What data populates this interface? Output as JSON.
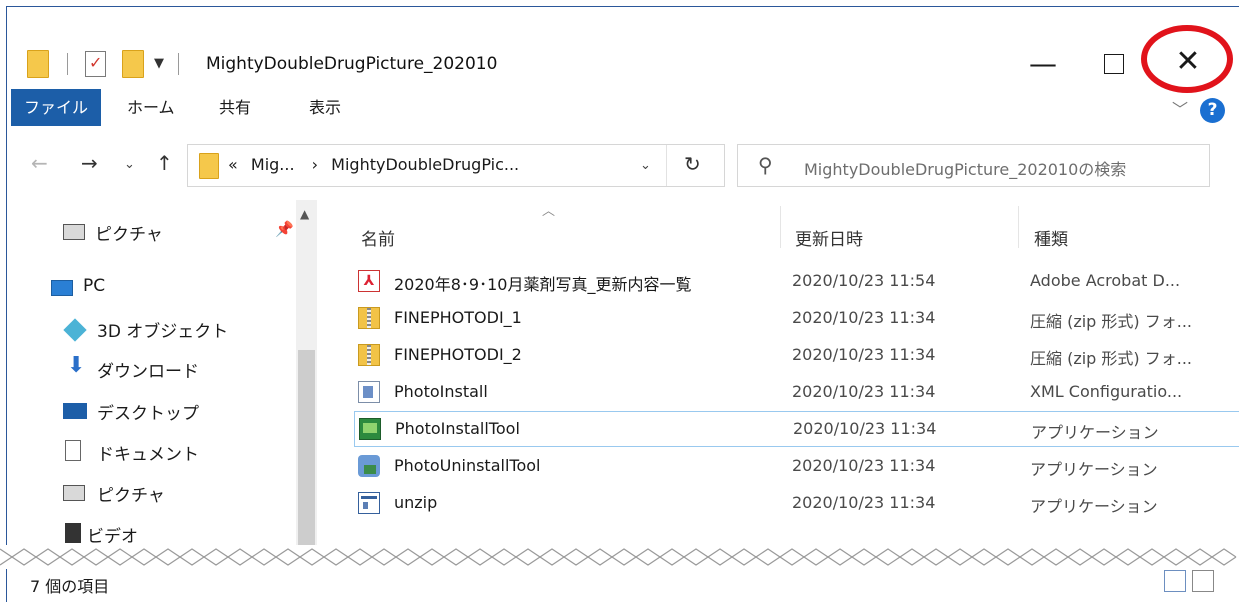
{
  "window": {
    "title": "MightyDoubleDrugPicture_202010",
    "minimize_glyph": "—",
    "close_glyph": "✕"
  },
  "ribbon": {
    "tabs": [
      "ファイル",
      "ホーム",
      "共有",
      "表示"
    ],
    "help_glyph": "?",
    "collapse_glyph": "﹀"
  },
  "address": {
    "overflow": "«",
    "crumb1": "Mig...",
    "sep": "›",
    "crumb2": "MightyDoubleDrugPic...",
    "dropdown_glyph": "⌄",
    "refresh_glyph": "↻"
  },
  "search": {
    "placeholder": "MightyDoubleDrugPicture_202010の検索"
  },
  "nav": {
    "back": "←",
    "forward": "→",
    "recent": "⌄",
    "up": "↑",
    "items": [
      {
        "label": "ピクチャ",
        "icon": "pictures-icon"
      },
      {
        "label": "PC",
        "icon": "pc-icon"
      },
      {
        "label": "3D オブジェクト",
        "icon": "3d-objects-icon"
      },
      {
        "label": "ダウンロード",
        "icon": "download-icon"
      },
      {
        "label": "デスクトップ",
        "icon": "desktop-icon"
      },
      {
        "label": "ドキュメント",
        "icon": "documents-icon"
      },
      {
        "label": "ピクチャ",
        "icon": "pictures-icon"
      },
      {
        "label": "ビデオ",
        "icon": "video-icon"
      }
    ]
  },
  "columns": {
    "name": "名前",
    "date": "更新日時",
    "type": "種類"
  },
  "files": [
    {
      "name": "2020年8･9･10月薬剤写真_更新内容一覧",
      "date": "2020/10/23 11:54",
      "type": "Adobe Acrobat D...",
      "icon": "pdf-icon"
    },
    {
      "name": "FINEPHOTODI_1",
      "date": "2020/10/23 11:34",
      "type": "圧縮 (zip 形式) フォ...",
      "icon": "zip-folder-icon"
    },
    {
      "name": "FINEPHOTODI_2",
      "date": "2020/10/23 11:34",
      "type": "圧縮 (zip 形式) フォ...",
      "icon": "zip-folder-icon"
    },
    {
      "name": "PhotoInstall",
      "date": "2020/10/23 11:34",
      "type": "XML Configuratio...",
      "icon": "xml-config-icon"
    },
    {
      "name": "PhotoInstallTool",
      "date": "2020/10/23 11:34",
      "type": "アプリケーション",
      "icon": "application-icon"
    },
    {
      "name": "PhotoUninstallTool",
      "date": "2020/10/23 11:34",
      "type": "アプリケーション",
      "icon": "uninstall-app-icon"
    },
    {
      "name": "unzip",
      "date": "2020/10/23 11:34",
      "type": "アプリケーション",
      "icon": "unzip-app-icon"
    }
  ],
  "status": {
    "item_count": "7 個の項目"
  },
  "colors": {
    "file_tab": "#1c5ea8",
    "highlight_circle": "#e1131b",
    "focus_border": "#99c9ef"
  }
}
